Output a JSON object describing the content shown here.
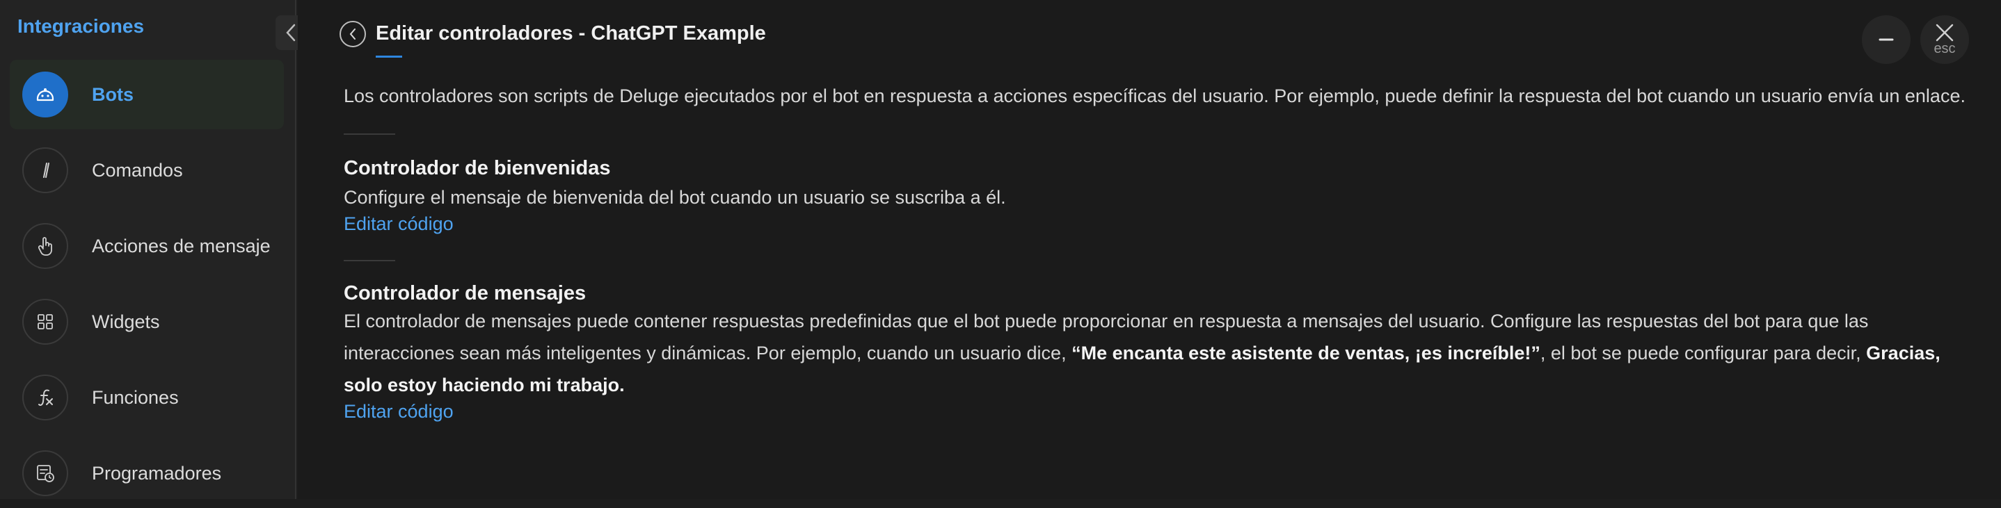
{
  "sidebar": {
    "title": "Integraciones",
    "items": [
      {
        "label": "Bots",
        "icon": "bot-icon",
        "active": true
      },
      {
        "label": "Comandos",
        "icon": "slash-icon",
        "active": false
      },
      {
        "label": "Acciones de mensaje",
        "icon": "tap-hand-icon",
        "active": false
      },
      {
        "label": "Widgets",
        "icon": "grid-icon",
        "active": false
      },
      {
        "label": "Funciones",
        "icon": "function-icon",
        "active": false
      },
      {
        "label": "Programadores",
        "icon": "scheduler-icon",
        "active": false
      }
    ]
  },
  "header": {
    "title": "Editar controladores - ChatGPT Example",
    "esc_label": "esc"
  },
  "intro": "Los controladores son scripts de Deluge ejecutados por el bot en respuesta a acciones específicas del usuario. Por ejemplo, puede definir la respuesta del bot cuando un usuario envía un enlace.",
  "sections": [
    {
      "title": "Controlador de bienvenidas",
      "text": "Configure el mensaje de bienvenida del bot cuando un usuario se suscriba a él.",
      "link": "Editar código"
    },
    {
      "title": "Controlador de mensajes",
      "text_parts": {
        "p1": "El controlador de mensajes puede contener respuestas predefinidas que el bot puede proporcionar en respuesta a mensajes del usuario. Configure las respuestas del bot para que las interacciones sean más inteligentes y dinámicas. Por ejemplo, cuando un usuario dice, ",
        "b1": "“Me encanta este asistente de ventas, ¡es increíble!”",
        "p2": ", el bot se puede configurar para decir, ",
        "b2": "Gracias, solo estoy haciendo mi trabajo."
      },
      "link": "Editar código"
    }
  ],
  "colors": {
    "accent": "#4fa3f0",
    "active_icon_bg": "#1f6fc9",
    "background": "#1b1b1b",
    "sidebar_bg": "#232323"
  }
}
